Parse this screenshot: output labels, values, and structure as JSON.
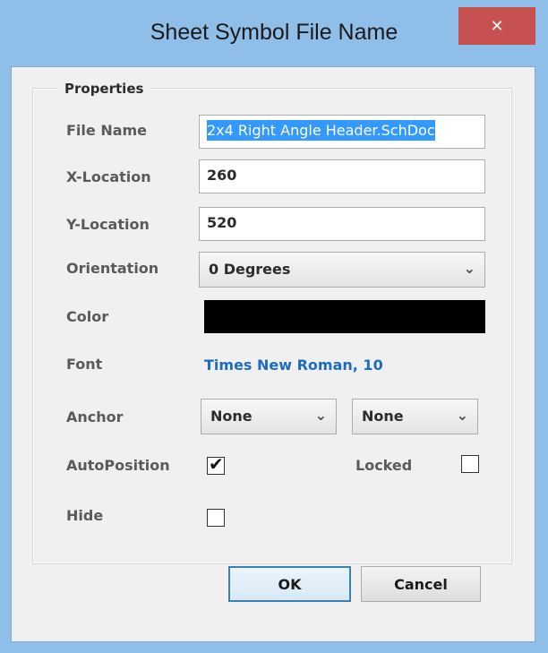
{
  "window": {
    "title": "Sheet Symbol File Name",
    "close_glyph": "✕",
    "accent": "#8fbfe8",
    "close_color": "#c75050"
  },
  "group": {
    "label": "Properties"
  },
  "fields": {
    "file_name_label": "File Name",
    "file_name_value": "2x4 Right Angle Header.SchDoc",
    "x_label": "X-Location",
    "x_value": "260",
    "y_label": "Y-Location",
    "y_value": "520",
    "orientation_label": "Orientation",
    "orientation_value": "0 Degrees",
    "color_label": "Color",
    "color_value": "#000000",
    "font_label": "Font",
    "font_value": "Times New Roman, 10",
    "anchor_label": "Anchor",
    "anchor_h_value": "None",
    "anchor_v_value": "None",
    "autoposition_label": "AutoPosition",
    "autoposition_checked": true,
    "locked_label": "Locked",
    "locked_checked": false,
    "hide_label": "Hide",
    "hide_checked": false
  },
  "icons": {
    "chevron": "chevron-down-icon",
    "check": "checkmark-icon",
    "close": "close-icon"
  },
  "glyphs": {
    "chevron": "⌄",
    "check": "✔"
  },
  "buttons": {
    "ok": "OK",
    "cancel": "Cancel"
  }
}
